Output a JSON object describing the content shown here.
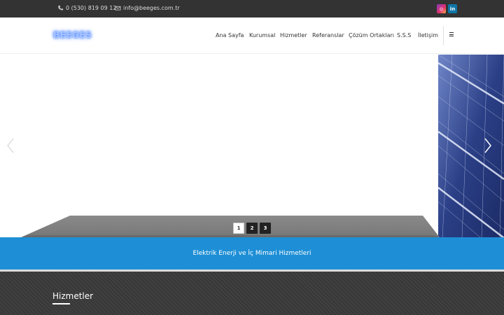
{
  "topbar": {
    "phone": "0 (530) 819 09 12",
    "email": "info@beeges.com.tr",
    "social": [
      {
        "name": "instagram",
        "icon": "instagram-icon",
        "glyph": "◎",
        "color": "#e1306c"
      },
      {
        "name": "linkedin",
        "icon": "linkedin-icon",
        "glyph": "in",
        "color": "#0e76a8"
      }
    ]
  },
  "header": {
    "logo": "BEEGES",
    "nav": [
      "Ana Sayfa",
      "Kurumsal",
      "Hizmetler",
      "Referanslar",
      "Çözüm Ortakları",
      "S.S.S",
      "İletişim"
    ],
    "menu_icon": "hamburger-icon"
  },
  "slider": {
    "pages": [
      "1",
      "2",
      "3"
    ],
    "active_page": "1",
    "prev_icon": "chevron-left-icon",
    "next_icon": "chevron-right-icon"
  },
  "banner": {
    "text": "Elektrik Enerji ve İç Mimari Hizmetleri",
    "color": "#1e8fd6"
  },
  "services": {
    "title": "Hizmetler"
  }
}
